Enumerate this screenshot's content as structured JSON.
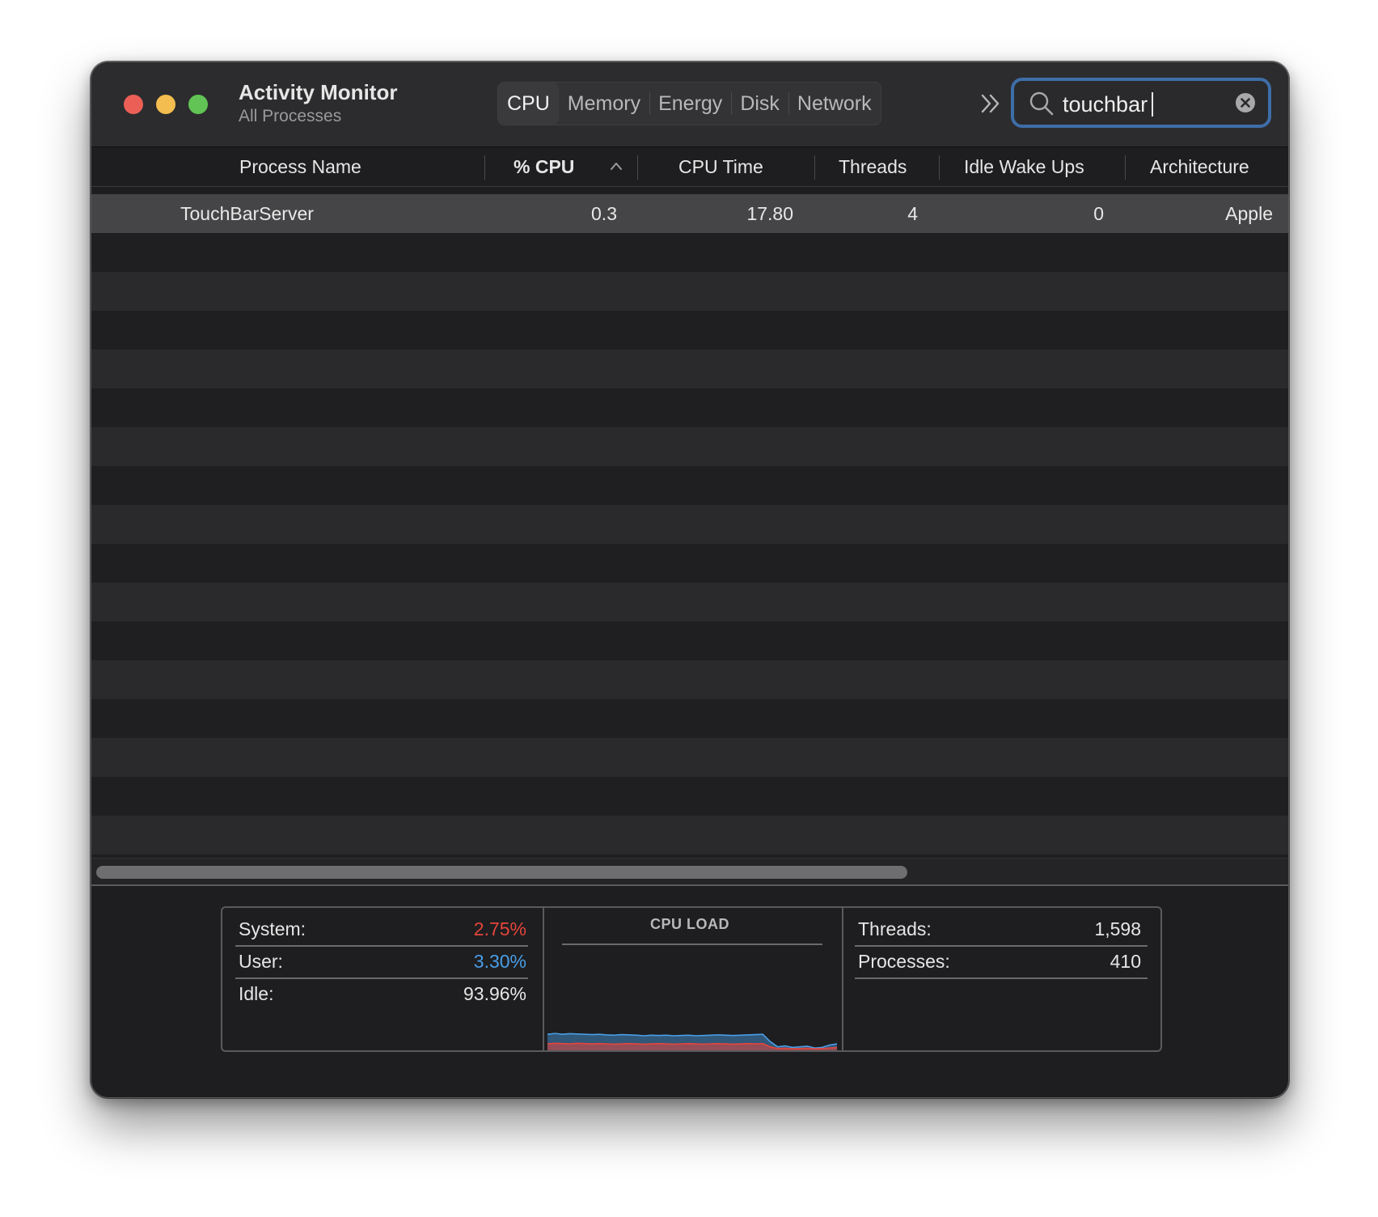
{
  "window": {
    "title": "Activity Monitor",
    "subtitle": "All Processes"
  },
  "tabs": [
    {
      "label": "CPU",
      "active": true
    },
    {
      "label": "Memory",
      "active": false
    },
    {
      "label": "Energy",
      "active": false
    },
    {
      "label": "Disk",
      "active": false
    },
    {
      "label": "Network",
      "active": false
    }
  ],
  "search": {
    "value": "touchbar",
    "icon": "magnifying-glass-icon"
  },
  "table": {
    "columns": [
      "Process Name",
      "% CPU",
      "CPU Time",
      "Threads",
      "Idle Wake Ups",
      "Architecture"
    ],
    "sorted_column": "% CPU",
    "sort_direction": "ascending",
    "rows": [
      {
        "process_name": "TouchBarServer",
        "cpu_percent": "0.3",
        "cpu_time": "17.80",
        "threads": "4",
        "idle_wake_ups": "0",
        "architecture": "Apple"
      }
    ]
  },
  "summary": {
    "system_label": "System:",
    "system_value": "2.75%",
    "user_label": "User:",
    "user_value": "3.30%",
    "idle_label": "Idle:",
    "idle_value": "93.96%",
    "cpu_load_title": "CPU LOAD",
    "threads_label": "Threads:",
    "threads_value": "1,598",
    "processes_label": "Processes:",
    "processes_value": "410"
  },
  "colors": {
    "system": "#e5453a",
    "user": "#4a9ee6",
    "search_focus": "#3e6ea8",
    "close": "#ec5f57",
    "minimize": "#f3bd4f",
    "maximize": "#61c454"
  },
  "cpu_load_history": {
    "user": [
      0.55,
      0.58,
      0.55,
      0.57,
      0.56,
      0.55,
      0.54,
      0.55,
      0.53,
      0.52,
      0.54,
      0.53,
      0.52,
      0.5,
      0.52,
      0.51,
      0.52,
      0.5,
      0.51,
      0.52,
      0.5,
      0.51,
      0.52,
      0.53,
      0.52,
      0.51,
      0.52,
      0.53,
      0.54,
      0.55,
      0.3,
      0.12,
      0.15,
      0.1,
      0.12,
      0.14,
      0.08,
      0.1,
      0.18,
      0.22
    ],
    "system": [
      0.22,
      0.24,
      0.23,
      0.22,
      0.24,
      0.23,
      0.22,
      0.23,
      0.22,
      0.21,
      0.22,
      0.23,
      0.22,
      0.21,
      0.22,
      0.23,
      0.22,
      0.21,
      0.22,
      0.23,
      0.22,
      0.21,
      0.22,
      0.23,
      0.22,
      0.21,
      0.22,
      0.23,
      0.22,
      0.23,
      0.12,
      0.06,
      0.07,
      0.05,
      0.06,
      0.07,
      0.05,
      0.06,
      0.08,
      0.1
    ]
  }
}
